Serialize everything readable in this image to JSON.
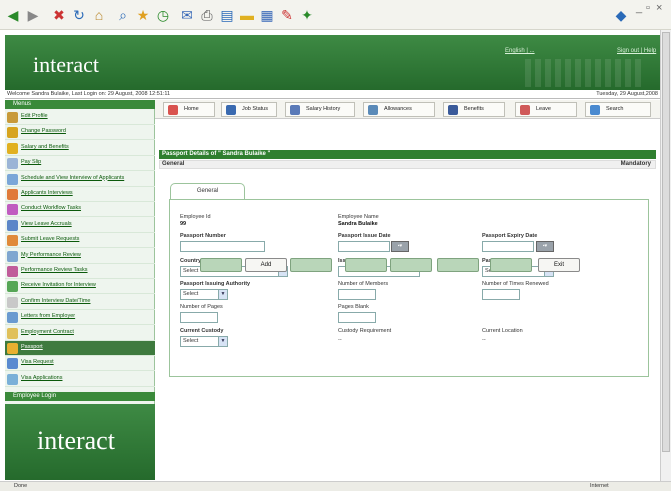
{
  "browser": {
    "window_controls": [
      "_",
      "▫",
      "×"
    ],
    "icons": [
      "back-icon",
      "forward-icon",
      "stop-icon",
      "refresh-icon",
      "home-icon",
      "search-icon",
      "favorites-icon",
      "history-icon",
      "mail-icon",
      "print-icon",
      "edit-icon",
      "folder-icon",
      "messenger-icon",
      "research-icon",
      "windows-logo-icon"
    ]
  },
  "header": {
    "logo": "interact",
    "language_link": "English | ...",
    "sign_out": "Sign out | Help"
  },
  "welcome": {
    "text": "Welcome Sandra Bulaike, Last Login on: 29 August, 2008 12:51:11",
    "date": "Tuesday, 29 August,2008"
  },
  "sidebar": {
    "menu_header": "Menus",
    "employee_login": "Employee Login",
    "logo": "interact",
    "items": [
      {
        "label": "Edit Profile",
        "color": "#c89a3a"
      },
      {
        "label": "Change Password",
        "color": "#d7a41e"
      },
      {
        "label": "Salary and Benefits",
        "color": "#e1b020"
      },
      {
        "label": "Pay Slip",
        "color": "#9bb4d6"
      },
      {
        "label": "Schedule and View Interview of Applicants",
        "color": "#7aa6d8"
      },
      {
        "label": "Applicants Interviews",
        "color": "#e07a3a"
      },
      {
        "label": "Conduct Workflow Tasks",
        "color": "#c05cc0"
      },
      {
        "label": "View Leave Accruals",
        "color": "#5c86c8"
      },
      {
        "label": "Submit Leave Requests",
        "color": "#e08a3a"
      },
      {
        "label": "My Performance Review",
        "color": "#7fa6d0"
      },
      {
        "label": "Performance Review Tasks",
        "color": "#c05c9a"
      },
      {
        "label": "Receive Invitation for Interview",
        "color": "#56a656"
      },
      {
        "label": "Confirm Interview Date/Time",
        "color": "#c8c8c8"
      },
      {
        "label": "Letters from Employer",
        "color": "#6a9ad0"
      },
      {
        "label": "Employment Contract",
        "color": "#e0c05a"
      },
      {
        "label": "Passport",
        "color": "#e8b030"
      },
      {
        "label": "Visa Request",
        "color": "#5a8ad0"
      },
      {
        "label": "Visa Applications",
        "color": "#7ab0d8"
      }
    ]
  },
  "nav": {
    "items": [
      {
        "label": "Home",
        "color": "#d9534f"
      },
      {
        "label": "Job Status",
        "color": "#3a6ab0"
      },
      {
        "label": "Salary History",
        "color": "#5a7ab8"
      },
      {
        "label": "Allowances",
        "color": "#5a8ab8"
      },
      {
        "label": "Benefits",
        "color": "#3a5a9a"
      },
      {
        "label": "Leave",
        "color": "#d05a5a"
      },
      {
        "label": "Search",
        "color": "#4a8ad0"
      }
    ]
  },
  "panel": {
    "title": "Passport Details of \" Sandra Bulaike \"",
    "section": "General",
    "mandatory": "Mandatory",
    "tab": "General"
  },
  "form": {
    "employee_id_label": "Employee Id",
    "employee_id_value": "99",
    "employee_name_label": "Employee Name",
    "employee_name_value": "Sandra Bulaike",
    "passport_number_label": "Passport Number",
    "passport_issue_date_label": "Passport Issue Date",
    "passport_expiry_date_label": "Passport Expiry Date",
    "country_label": "Country",
    "country_value": "Select",
    "issue_place_label": "Issue Place",
    "passport_type_label": "Passport Type",
    "passport_type_value": "Select",
    "issuing_authority_label": "Passport Issuing Authority",
    "issuing_authority_value": "Select",
    "number_of_members_label": "Number of Members",
    "times_renewed_label": "Number of Times Renewed",
    "number_of_pages_label": "Number of Pages",
    "pages_blank_label": "Pages Blank",
    "current_custody_label": "Current Custody",
    "current_custody_value": "Select",
    "custody_requirement_label": "Custody Requirement",
    "custody_requirement_value": "--",
    "current_location_label": "Current Location",
    "current_location_value": "--"
  },
  "actions": {
    "add": "Add",
    "exit": "Exit"
  },
  "status": {
    "left": "Done",
    "right": "Internet"
  }
}
